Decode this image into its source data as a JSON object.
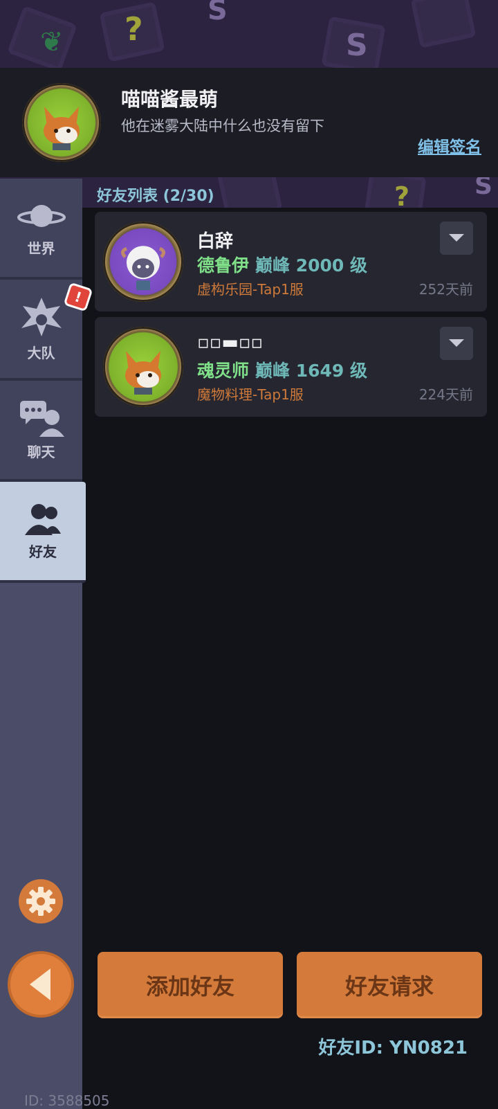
{
  "profile": {
    "name": "喵喵酱最萌",
    "signature": "他在迷雾大陆中什么也没有留下",
    "edit_label": "编辑签名"
  },
  "sidebar": {
    "tabs": [
      {
        "label": "世界",
        "icon": "planet-icon"
      },
      {
        "label": "大队",
        "icon": "guild-emblem-icon"
      },
      {
        "label": "聊天",
        "icon": "chat-icon"
      },
      {
        "label": "好友",
        "icon": "friends-icon"
      }
    ],
    "badge": "!",
    "player_id": "ID: 3588505"
  },
  "friends": {
    "title": "好友列表 (2/30)",
    "items": [
      {
        "name": "白辞",
        "class": "德鲁伊",
        "level": "巅峰 2000 级",
        "server": "虚构乐园-Tap1服",
        "last_seen": "252天前",
        "avatar": "sheep-avatar"
      },
      {
        "name": "▫▫▬▫▫",
        "class": "魂灵师",
        "level": "巅峰 1649 级",
        "server": "魔物料理-Tap1服",
        "last_seen": "224天前",
        "avatar": "fox-avatar"
      }
    ]
  },
  "actions": {
    "add_friend": "添加好友",
    "friend_requests": "好友请求",
    "friend_id": "好友ID: YN0821"
  },
  "colors": {
    "accent_orange": "#d47a3b",
    "sidebar": "#4b4c68",
    "active_tab": "#c2cde0",
    "class_green": "#7fe089",
    "server_orange": "#cf7a3a"
  }
}
